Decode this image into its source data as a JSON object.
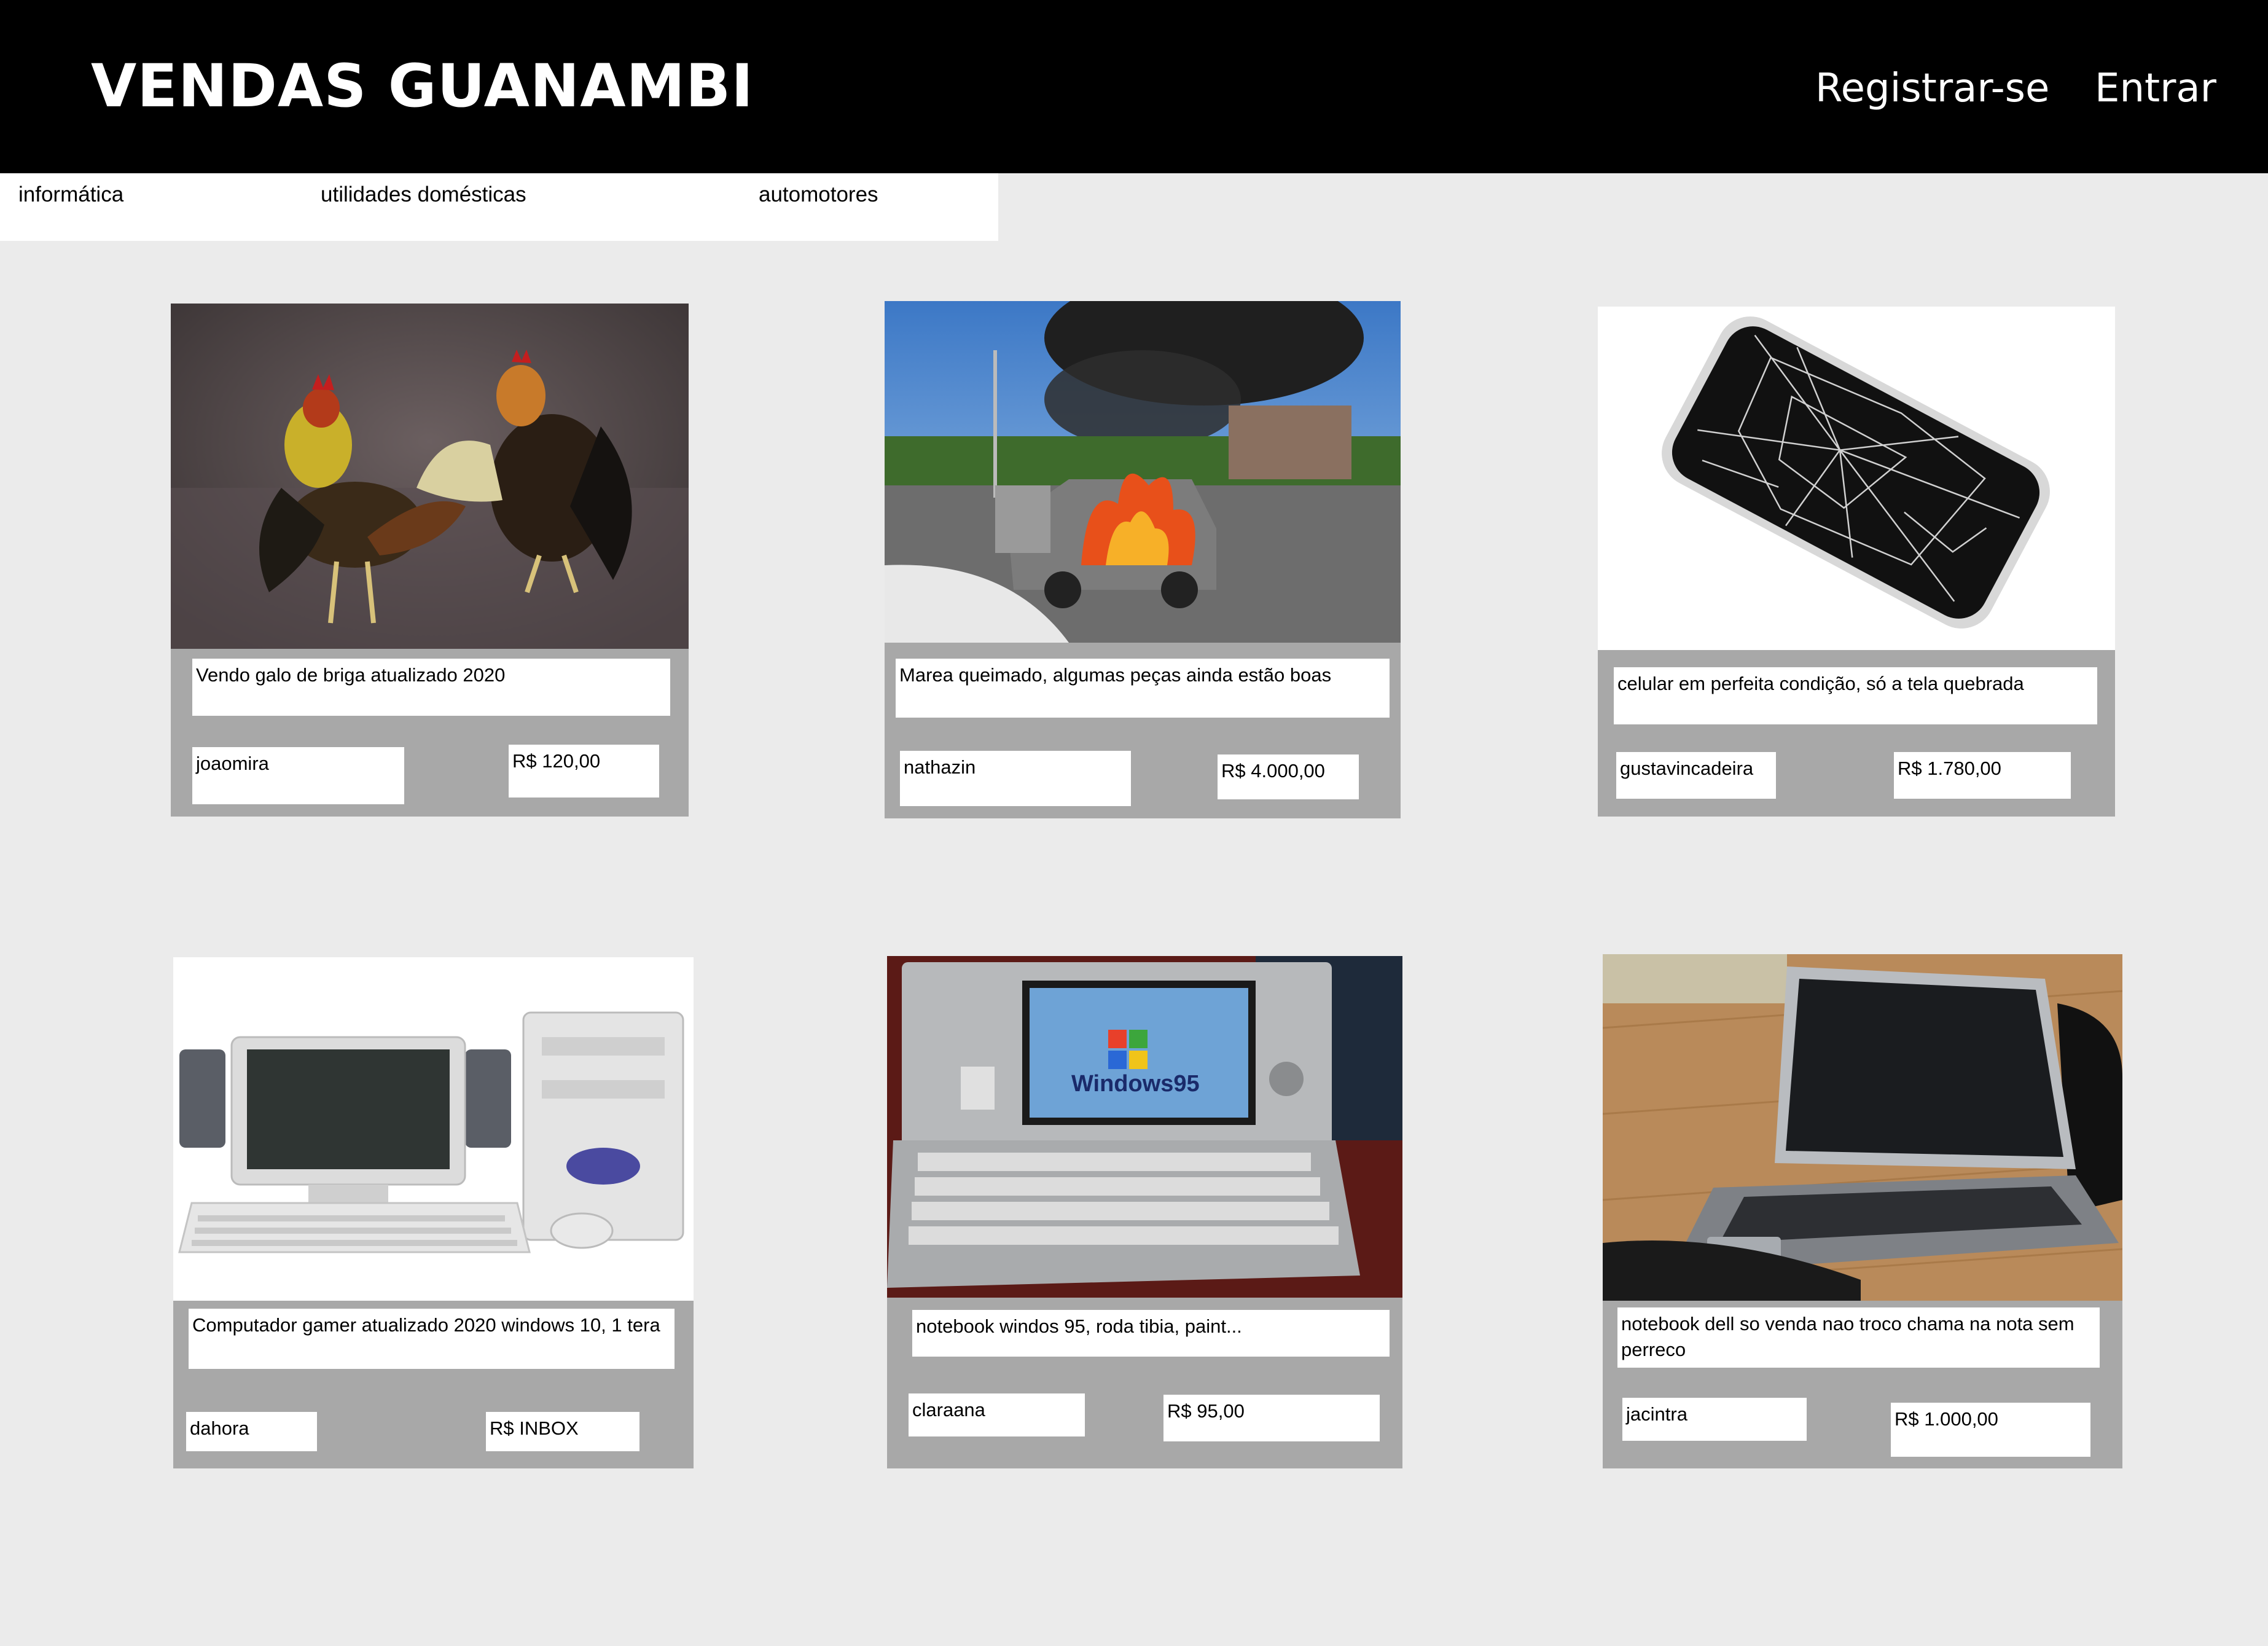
{
  "header": {
    "brand": "VENDAS GUANAMBI",
    "register_label": "Registrar-se",
    "login_label": "Entrar"
  },
  "categories": [
    {
      "label": "informática"
    },
    {
      "label": "utilidades domésticas"
    },
    {
      "label": "automotores"
    }
  ],
  "listings": [
    {
      "description": "Vendo galo de briga atualizado 2020",
      "seller": "joaomira",
      "price": "R$ 120,00",
      "image_icon": "roosters-photo"
    },
    {
      "description": "Marea queimado, algumas peças ainda estão boas",
      "seller": "nathazin",
      "price": "R$ 4.000,00",
      "image_icon": "burning-car-photo"
    },
    {
      "description": "celular em perfeita condição, só a tela quebrada",
      "seller": "gustavincadeira",
      "price": "R$ 1.780,00",
      "image_icon": "cracked-phone-photo"
    },
    {
      "description": "Computador gamer atualizado 2020 windows 10, 1 tera",
      "seller": "dahora",
      "price": "R$ INBOX",
      "image_icon": "desktop-computer-photo"
    },
    {
      "description": "notebook windos 95, roda tibia, paint...",
      "seller": "claraana",
      "price": "R$ 95,00",
      "image_icon": "old-laptop-photo"
    },
    {
      "description": "notebook dell so venda nao troco chama na nota sem perreco",
      "seller": "jacintra",
      "price": "R$ 1.000,00",
      "image_icon": "laptop-photo"
    }
  ],
  "colors": {
    "header_bg": "#000000",
    "page_bg": "#ebebeb",
    "panel_bg": "#a8a8a8"
  }
}
